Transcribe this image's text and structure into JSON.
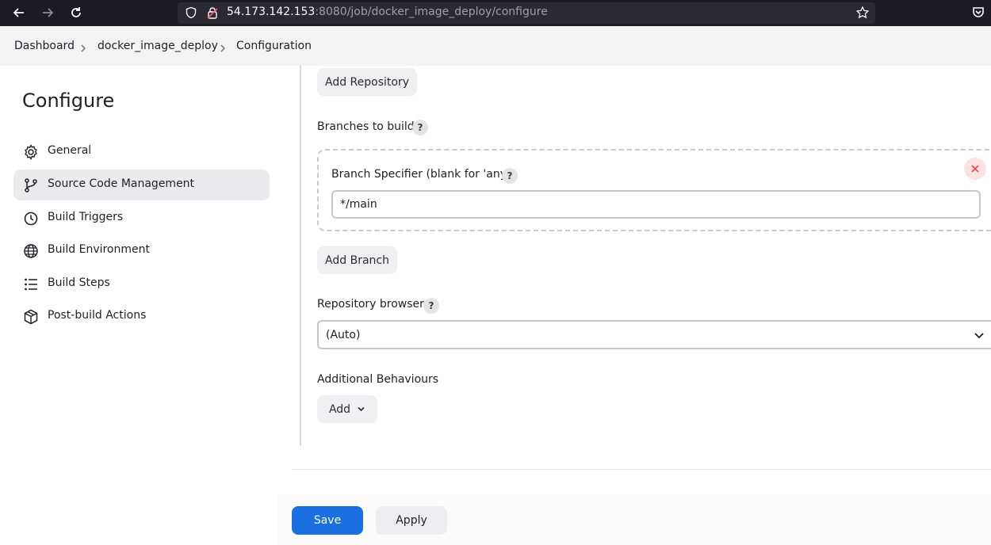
{
  "browser": {
    "url_host": "54.173.142.153",
    "url_rest": ":8080/job/docker_image_deploy/configure"
  },
  "breadcrumb": [
    "Dashboard",
    "docker_image_deploy",
    "Configuration"
  ],
  "sidebar": {
    "title": "Configure",
    "items": [
      {
        "label": "General",
        "icon": "gear-icon",
        "active": false
      },
      {
        "label": "Source Code Management",
        "icon": "branch-icon",
        "active": true
      },
      {
        "label": "Build Triggers",
        "icon": "timer-icon",
        "active": false
      },
      {
        "label": "Build Environment",
        "icon": "globe-icon",
        "active": false
      },
      {
        "label": "Build Steps",
        "icon": "list-icon",
        "active": false
      },
      {
        "label": "Post-build Actions",
        "icon": "package-icon",
        "active": false
      }
    ]
  },
  "main": {
    "add_repository": "Add Repository",
    "branches_label": "Branches to build",
    "help_glyph": "?",
    "branch_specifier_label": "Branch Specifier (blank for 'any')",
    "branch_specifier_value": "*/main",
    "add_branch": "Add Branch",
    "repo_browser_label": "Repository browser",
    "repo_browser_value": "(Auto)",
    "additional_label": "Additional Behaviours",
    "add_button": "Add"
  },
  "footer": {
    "save": "Save",
    "apply": "Apply"
  },
  "colors": {
    "primary": "#1b6fe0",
    "danger": "#e5484d"
  }
}
